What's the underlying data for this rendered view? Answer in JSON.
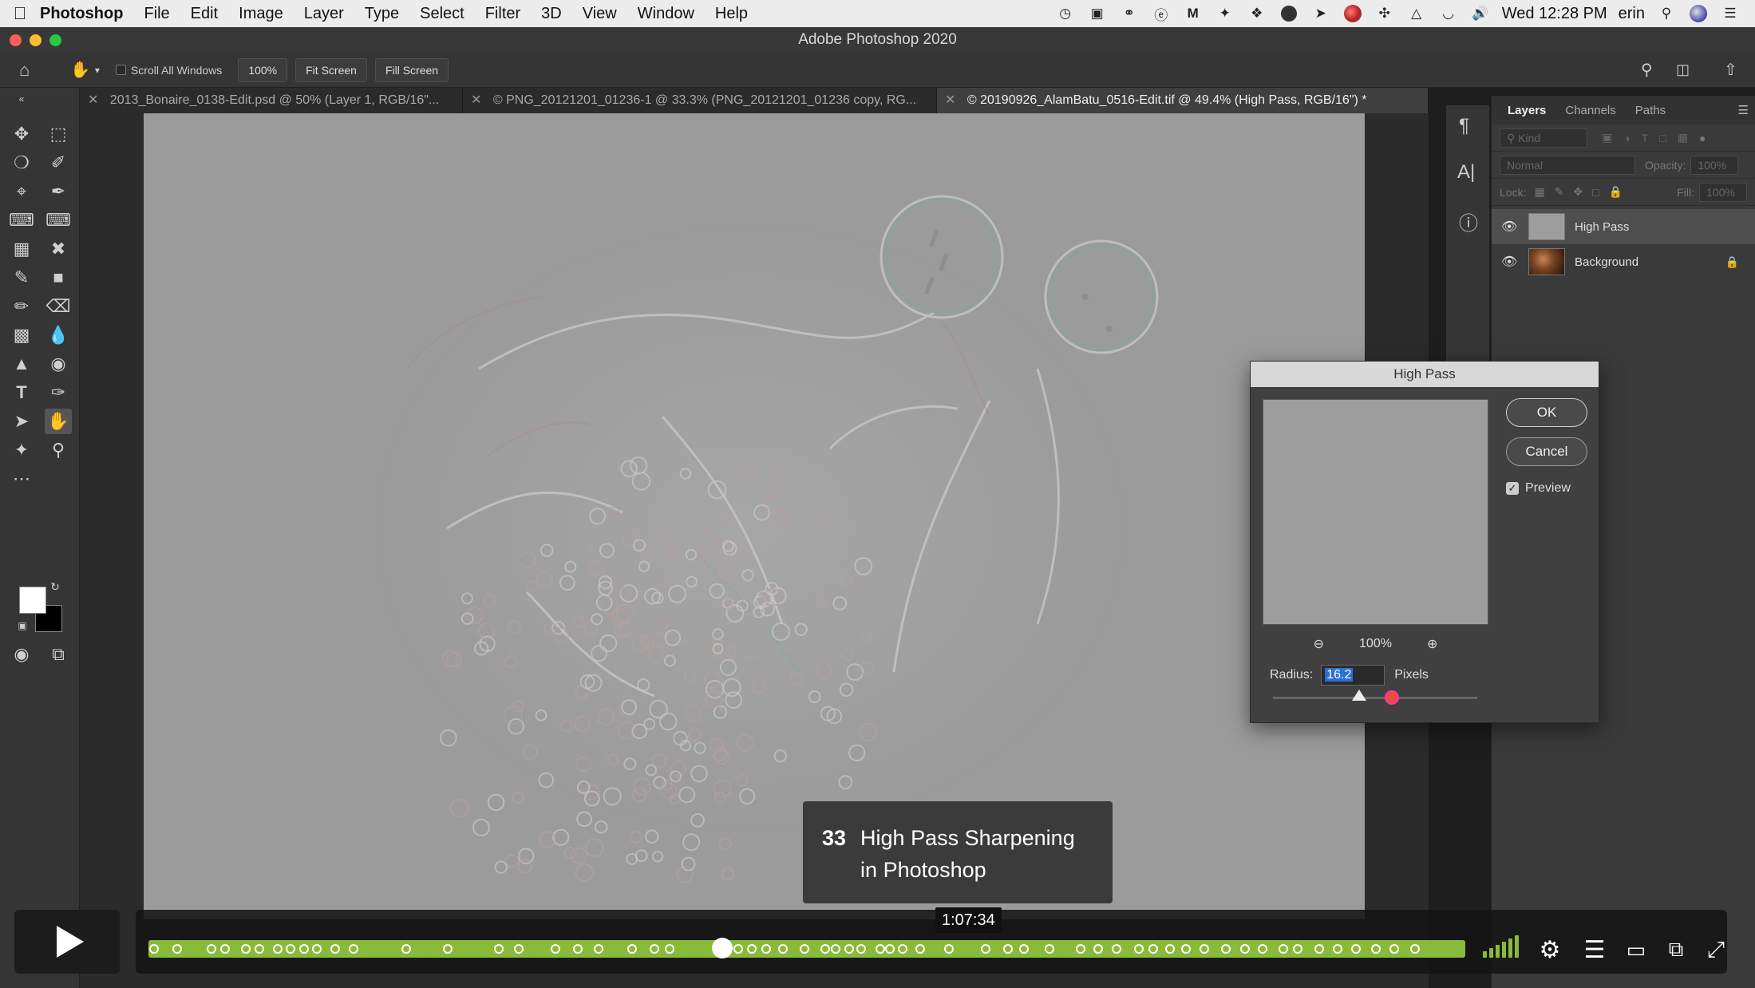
{
  "menubar": {
    "app_name": "Photoshop",
    "menus": [
      "File",
      "Edit",
      "Image",
      "Layer",
      "Type",
      "Select",
      "Filter",
      "3D",
      "View",
      "Window",
      "Help"
    ],
    "clock": "Wed 12:28 PM",
    "user": "erin"
  },
  "window": {
    "title": "Adobe Photoshop 2020"
  },
  "options_bar": {
    "scroll_all_windows_label": "Scroll All Windows",
    "zoom_value": "100%",
    "fit_screen_label": "Fit Screen",
    "fill_screen_label": "Fill Screen"
  },
  "tabs": [
    {
      "label": "2013_Bonaire_0138-Edit.psd @ 50% (Layer 1, RGB/16\"...",
      "active": false
    },
    {
      "label": "© PNG_20121201_01236-1 @ 33.3% (PNG_20121201_01236 copy, RG...",
      "active": false
    },
    {
      "label": "© 20190926_AlamBatu_0516-Edit.tif @ 49.4% (High Pass, RGB/16\") *",
      "active": true
    }
  ],
  "layers_panel": {
    "tabs": [
      "Layers",
      "Channels",
      "Paths"
    ],
    "kind_placeholder": "Kind",
    "blend_mode": "Normal",
    "opacity_label": "Opacity:",
    "opacity_value": "100%",
    "lock_label": "Lock:",
    "fill_label": "Fill:",
    "fill_value": "100%",
    "layers": [
      {
        "name": "High Pass",
        "selected": true
      },
      {
        "name": "Background",
        "selected": false,
        "locked": true
      }
    ]
  },
  "high_pass_dialog": {
    "title": "High Pass",
    "ok_label": "OK",
    "cancel_label": "Cancel",
    "preview_label": "Preview",
    "preview_checked": true,
    "zoom_level": "100%",
    "radius_label": "Radius:",
    "radius_value": "16.2",
    "units_label": "Pixels",
    "slider_fraction": 0.42
  },
  "status_bar": {
    "zoom": "49.35%"
  },
  "video_player": {
    "caption_number": "33",
    "caption_title": "High Pass Sharpening in Photoshop",
    "hover_time": "1:07:34",
    "progress_fraction": 0.436,
    "accent_color": "#88bb3a"
  }
}
